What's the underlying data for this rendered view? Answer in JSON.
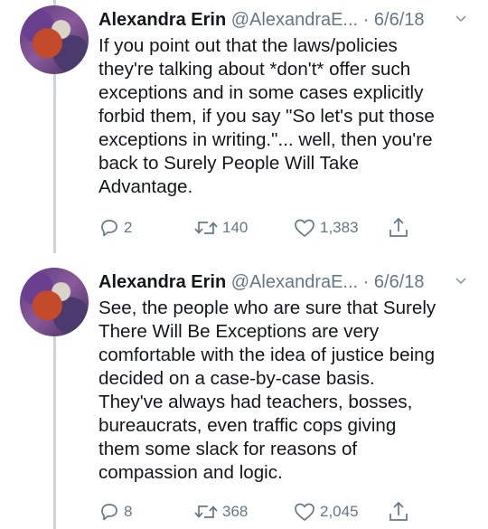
{
  "tweets": [
    {
      "author_name": "Alexandra Erin",
      "author_handle": "@AlexandraE...",
      "separator": "·",
      "date": "6/6/18",
      "text_lines": [
        "If you point out that the laws/policies",
        "they're talking about *don't* offer such",
        "exceptions and in some cases explicitly",
        "forbid them, if you say \"So let's put those",
        "exceptions in writing.\"... well, then you're",
        "back to Surely People Will Take",
        "Advantage."
      ],
      "replies": "2",
      "retweets": "140",
      "likes": "1,383"
    },
    {
      "author_name": "Alexandra Erin",
      "author_handle": "@AlexandraE...",
      "separator": "·",
      "date": "6/6/18",
      "text_lines": [
        "See, the people who are sure that Surely",
        "There Will Be Exceptions are very",
        "comfortable with the idea of justice being",
        "decided on a case-by-case basis.",
        "They've always had teachers, bosses,",
        "bureaucrats, even traffic cops giving",
        "them some slack for reasons of",
        "compassion and logic."
      ],
      "replies": "8",
      "retweets": "368",
      "likes": "2,045"
    }
  ],
  "icons": {
    "reply": "reply-icon",
    "retweet": "retweet-icon",
    "like": "heart-icon",
    "share": "share-icon",
    "menu": "chevron-down-icon"
  },
  "colors": {
    "text": "#14171a",
    "secondary": "#657786",
    "thread_line": "#c8d3da"
  }
}
